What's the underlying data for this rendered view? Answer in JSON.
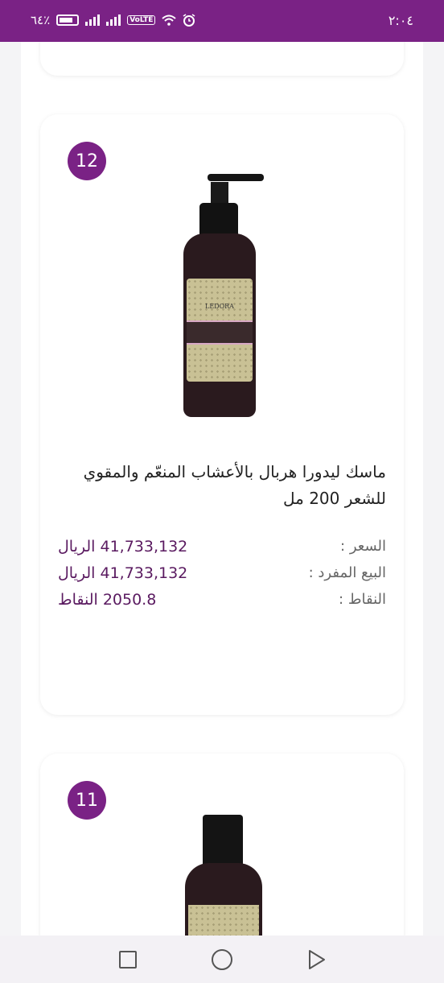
{
  "status_bar": {
    "time": "٢:٠٤",
    "battery": "٦٤٪"
  },
  "product": {
    "rank": "12",
    "title": "ماسك ليدورا هربال بالأعشاب المنعّم والمقوي للشعر 200 مل",
    "image_brand": "LEDORA",
    "price_label": "السعر :",
    "price_value": "41,733,132 الريال",
    "single_sale_label": "البيع المفرد :",
    "single_sale_value": "41,733,132 الريال",
    "points_label": "النقاط :",
    "points_value": "2050.8 النقاط"
  },
  "next_product": {
    "rank": "11"
  },
  "colors": {
    "accent": "#7a2285",
    "value_text": "#5a1a60"
  },
  "icons": [
    "battery-icon",
    "signal-icon",
    "wifi-icon",
    "alarm-icon",
    "recents-icon",
    "home-icon",
    "back-icon"
  ]
}
